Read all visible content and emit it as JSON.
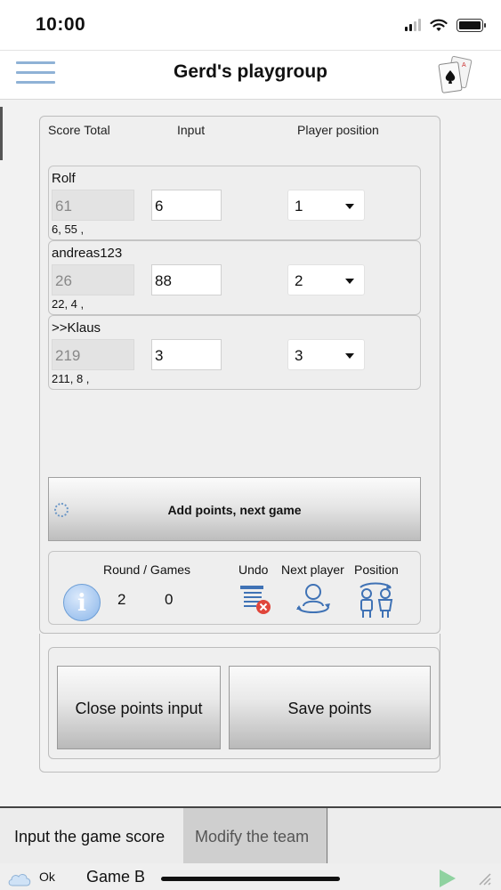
{
  "status_bar": {
    "time": "10:00"
  },
  "header": {
    "title": "Gerd's playgroup"
  },
  "columns": {
    "score_total": "Score Total",
    "input": "Input",
    "player_position": "Player position"
  },
  "players": [
    {
      "name": "Rolf",
      "total": "61",
      "input": "6",
      "history": "6, 55 ,",
      "position": "1"
    },
    {
      "name": "andreas123",
      "total": "26",
      "input": "88",
      "history": "22, 4 ,",
      "position": "2"
    },
    {
      "name": ">>Klaus",
      "total": "219",
      "input": "3",
      "history": "211, 8 ,",
      "position": "3"
    }
  ],
  "add_button": {
    "label": "Add points, next game"
  },
  "stats": {
    "round_games_label": "Round / Games",
    "round": "2",
    "games": "0",
    "undo_label": "Undo",
    "next_player_label": "Next player",
    "position_label": "Position"
  },
  "actions": {
    "close_label": "Close points input",
    "save_label": "Save points"
  },
  "tabs": [
    {
      "label": "Input the game score",
      "active": true
    },
    {
      "label": "Modify the team",
      "active": false
    }
  ],
  "footer": {
    "status": "Ok",
    "game": "Game B"
  },
  "icons": {
    "menu": "hamburger-icon",
    "app": "playing-cards-icon",
    "info": "info-icon",
    "undo": "undo-list-icon",
    "next_player": "next-player-icon",
    "position": "position-swap-icon",
    "cloud": "cloud-icon",
    "play": "play-icon"
  },
  "colors": {
    "accent": "#8fb2d6",
    "info": "#8ab6ea",
    "play": "#8fd2a0",
    "undo_x": "#e0453a"
  }
}
